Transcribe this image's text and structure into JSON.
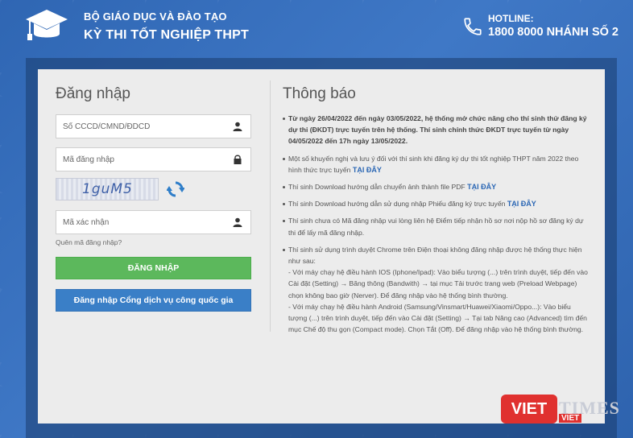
{
  "header": {
    "ministry": "BỘ GIÁO DỤC VÀ ĐÀO TẠO",
    "exam_title": "KỲ THI TỐT NGHIỆP THPT",
    "hotline_label": "HOTLINE:",
    "hotline_number": "1800 8000 NHÁNH SỐ 2"
  },
  "login": {
    "title": "Đăng nhập",
    "id_placeholder": "Số CCCD/CMND/ĐDCD",
    "id_value": "",
    "code_placeholder": "Mã đăng nhập",
    "code_value": "",
    "captcha_text": "1guM5",
    "verify_placeholder": "Mã xác nhận",
    "verify_value": "",
    "forgot_label": "Quên mã đăng nhập?",
    "login_button": "ĐĂNG NHẬP",
    "national_button": "Đăng nhập Cổng dịch vụ công quốc gia"
  },
  "notices": {
    "title": "Thông báo",
    "item1": "Từ ngày 26/04/2022 đến ngày 03/05/2022, hệ thống mở chức năng cho thí sinh thử đăng ký dự thi (ĐKDT) trực tuyến trên hệ thống. Thí sinh chính thức ĐKDT trực tuyến từ ngày 04/05/2022 đến 17h ngày 13/05/2022.",
    "item2": "Một số khuyến nghị và lưu ý đối với thí sinh khi đăng ký dự thi tốt nghiệp THPT năm 2022 theo hình thức trực tuyến",
    "item3": "Thí sinh Download hướng dẫn chuyển ảnh thành file PDF",
    "item4": "Thí sinh Download hướng dẫn sử dụng nhập Phiếu đăng ký trực tuyến",
    "item5": "Thí sinh chưa có Mã đăng nhập vui lòng liên hệ Điểm tiếp nhận hồ sơ nơi nộp hồ sơ đăng ký dự thi để lấy mã đăng nhập.",
    "item6_intro": "Thí sinh sử dụng trình duyệt Chrome trên Điện thoại không đăng nhập được hệ thống thực hiện như sau:",
    "item6_ios": "- Với máy chạy hệ điều hành IOS (Iphone/Ipad): Vào biểu tượng (...) trên trình duyệt, tiếp đến vào Cài đặt (Setting) → Băng thông (Bandwith) → tại mục Tải trước trang web (Preload Webpage) chọn không bao giờ (Nerver). Để đăng nhập vào hệ thống bình thường.",
    "item6_android": "- Với máy chạy hệ điều hành Android (Samsung/Vinsmart/Huawei/Xiaomi/Oppo...): Vào biểu tượng (...) trên trình duyệt, tiếp đến vào Cài đặt (Setting) → Tại tab Nâng cao (Advanced) tìm đến mục Chế độ thu gọn (Compact mode). Chọn Tắt (Off). Để đăng nhập vào hệ thống bình thường.",
    "link_label": "TẠI ĐÂY"
  },
  "watermark": {
    "viet": "VIET",
    "times": "TIMES",
    "small": "VIET"
  }
}
